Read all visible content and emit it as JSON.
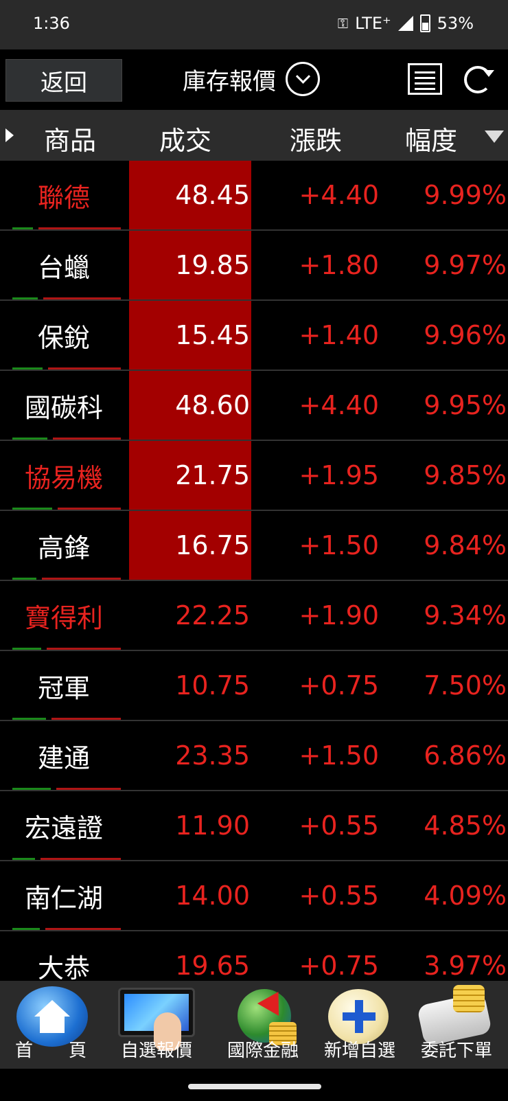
{
  "status_bar": {
    "time": "1:36",
    "network": "LTE⁺",
    "battery": "53%"
  },
  "header": {
    "back_label": "返回",
    "title": "庫存報價"
  },
  "columns": {
    "product": "商品",
    "price": "成交",
    "change": "漲跌",
    "percent": "幅度"
  },
  "rows": [
    {
      "name": "聯德",
      "price": "48.45",
      "change": "+4.40",
      "percent": "9.99%",
      "name_color": "red",
      "limit_up": true
    },
    {
      "name": "台蠟",
      "price": "19.85",
      "change": "+1.80",
      "percent": "9.97%",
      "name_color": "white",
      "limit_up": true
    },
    {
      "name": "保銳",
      "price": "15.45",
      "change": "+1.40",
      "percent": "9.96%",
      "name_color": "white",
      "limit_up": true
    },
    {
      "name": "國碳科",
      "price": "48.60",
      "change": "+4.40",
      "percent": "9.95%",
      "name_color": "white",
      "limit_up": true
    },
    {
      "name": "協易機",
      "price": "21.75",
      "change": "+1.95",
      "percent": "9.85%",
      "name_color": "red",
      "limit_up": true
    },
    {
      "name": "高鋒",
      "price": "16.75",
      "change": "+1.50",
      "percent": "9.84%",
      "name_color": "white",
      "limit_up": true
    },
    {
      "name": "寶得利",
      "price": "22.25",
      "change": "+1.90",
      "percent": "9.34%",
      "name_color": "red",
      "limit_up": false
    },
    {
      "name": "冠軍",
      "price": "10.75",
      "change": "+0.75",
      "percent": "7.50%",
      "name_color": "white",
      "limit_up": false
    },
    {
      "name": "建通",
      "price": "23.35",
      "change": "+1.50",
      "percent": "6.86%",
      "name_color": "white",
      "limit_up": false
    },
    {
      "name": "宏遠證",
      "price": "11.90",
      "change": "+0.55",
      "percent": "4.85%",
      "name_color": "white",
      "limit_up": false
    },
    {
      "name": "南仁湖",
      "price": "14.00",
      "change": "+0.55",
      "percent": "4.09%",
      "name_color": "white",
      "limit_up": false
    },
    {
      "name": "大恭",
      "price": "19.65",
      "change": "+0.75",
      "percent": "3.97%",
      "name_color": "white",
      "limit_up": false
    }
  ],
  "nav": [
    {
      "label": "首　　頁",
      "icon": "home-icon"
    },
    {
      "label": "自選報價",
      "icon": "tablet-chart-icon"
    },
    {
      "label": "國際金融",
      "icon": "globe-icon"
    },
    {
      "label": "新增自選",
      "icon": "plus-icon"
    },
    {
      "label": "委託下單",
      "icon": "order-icon"
    }
  ],
  "colors": {
    "up_red": "#e8231f",
    "limit_bg": "#a30000",
    "header_bg": "#2c2c2c"
  }
}
